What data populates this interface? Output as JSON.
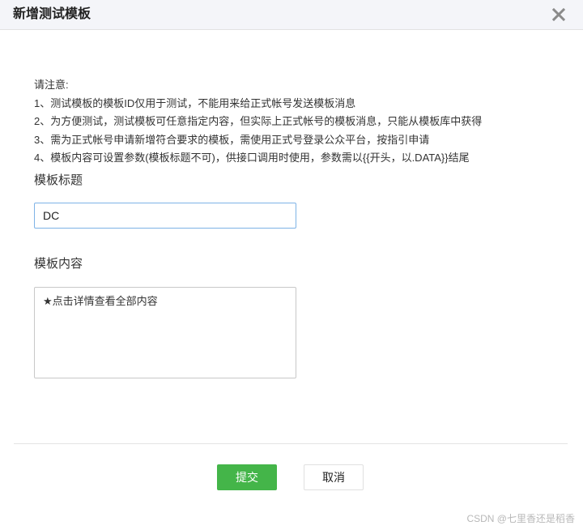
{
  "dialog": {
    "title": "新增测试模板",
    "close_icon": "close-icon"
  },
  "notes": {
    "heading": "请注意:",
    "lines": [
      "1、测试模板的模板ID仅用于测试，不能用来给正式帐号发送模板消息",
      "2、为方便测试，测试模板可任意指定内容，但实际上正式帐号的模板消息，只能从模板库中获得",
      "3、需为正式帐号申请新增符合要求的模板，需使用正式号登录公众平台，按指引申请",
      "4、模板内容可设置参数(模板标题不可)，供接口调用时使用，参数需以{{开头，以.DATA}}结尾"
    ]
  },
  "form": {
    "title_label": "模板标题",
    "title_value": "DC",
    "content_label": "模板内容",
    "content_value": "★点击详情查看全部内容"
  },
  "actions": {
    "submit_label": "提交",
    "cancel_label": "取消"
  },
  "watermark": "CSDN @七里香还是稻香",
  "colors": {
    "header_bg": "#f4f5f9",
    "submit_green": "#44b549",
    "input_focus_border": "#7eb3e6"
  }
}
